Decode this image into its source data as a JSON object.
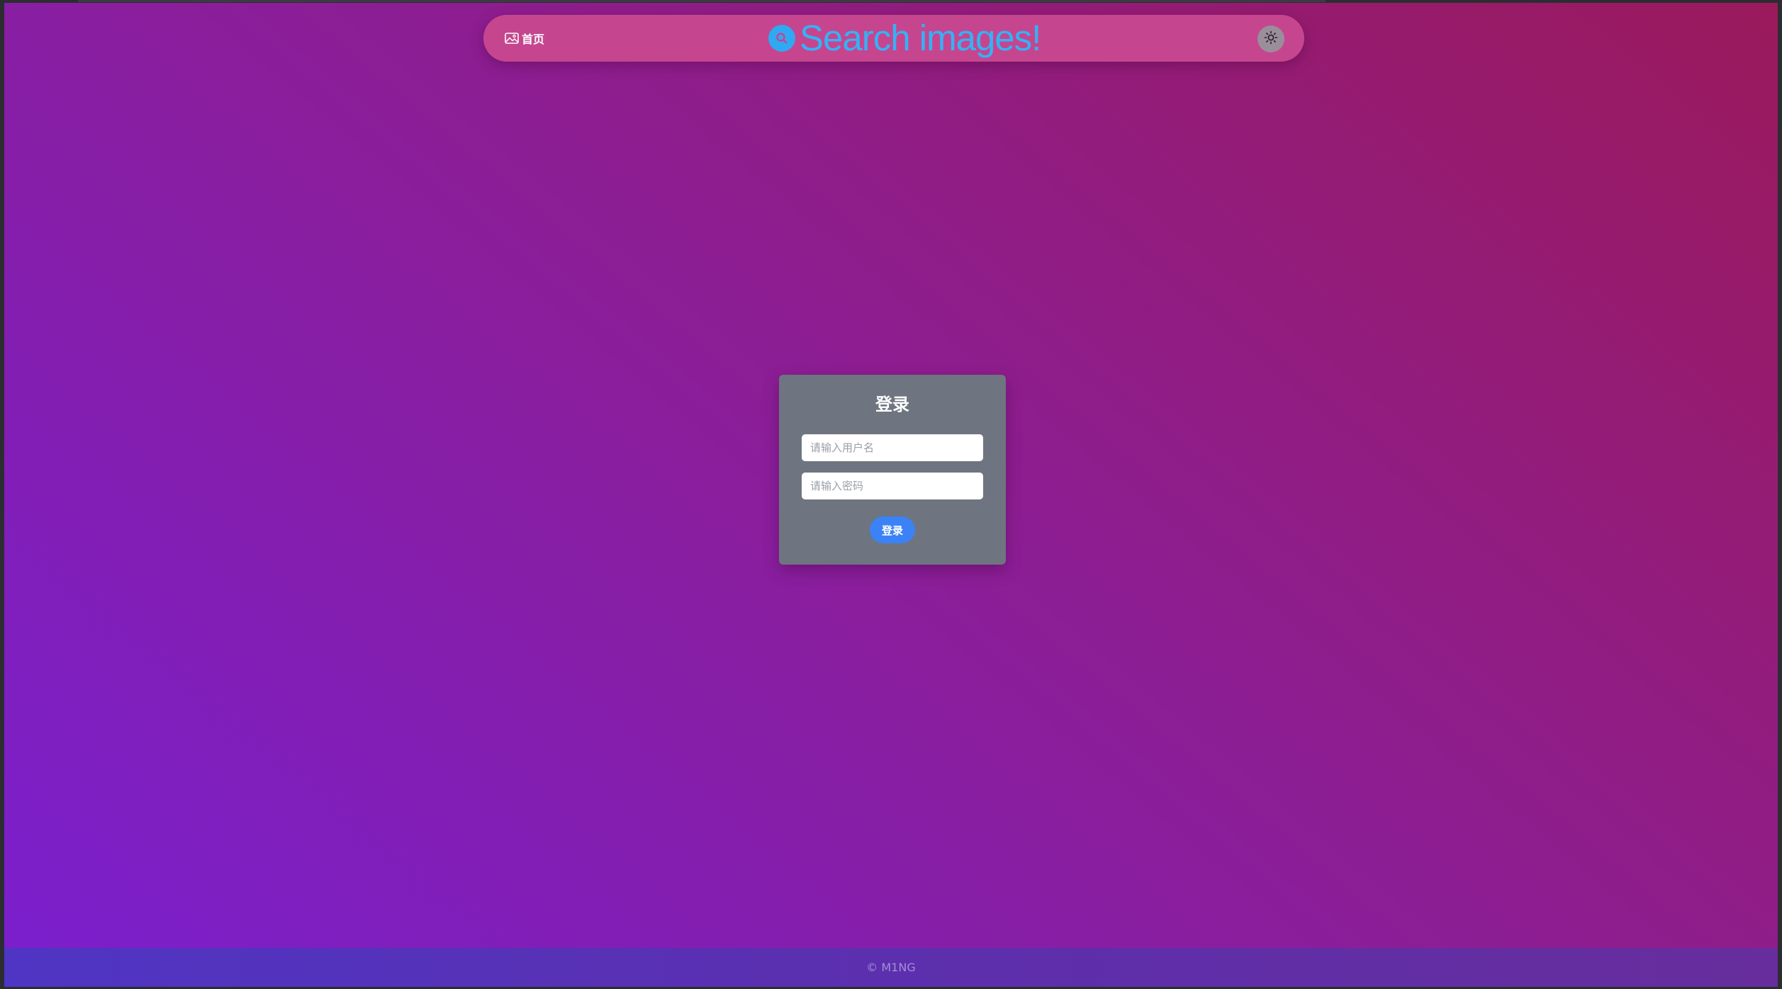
{
  "header": {
    "home_label": "首页",
    "home_icon": "image-icon",
    "search_title": "Search images!",
    "search_icon": "search-icon",
    "theme_icon": "sun-icon"
  },
  "login": {
    "title": "登录",
    "username_placeholder": "请输入用户名",
    "password_placeholder": "请输入密码",
    "submit_label": "登录"
  },
  "footer": {
    "copyright": "© M1NG"
  },
  "colors": {
    "gradient_start": "#7a1fcf",
    "gradient_end": "#9b1a5c",
    "header_bg": "#c5468f",
    "search_accent": "#35b2f4",
    "card_bg": "#6e7480",
    "button_bg": "#3b82f6"
  }
}
